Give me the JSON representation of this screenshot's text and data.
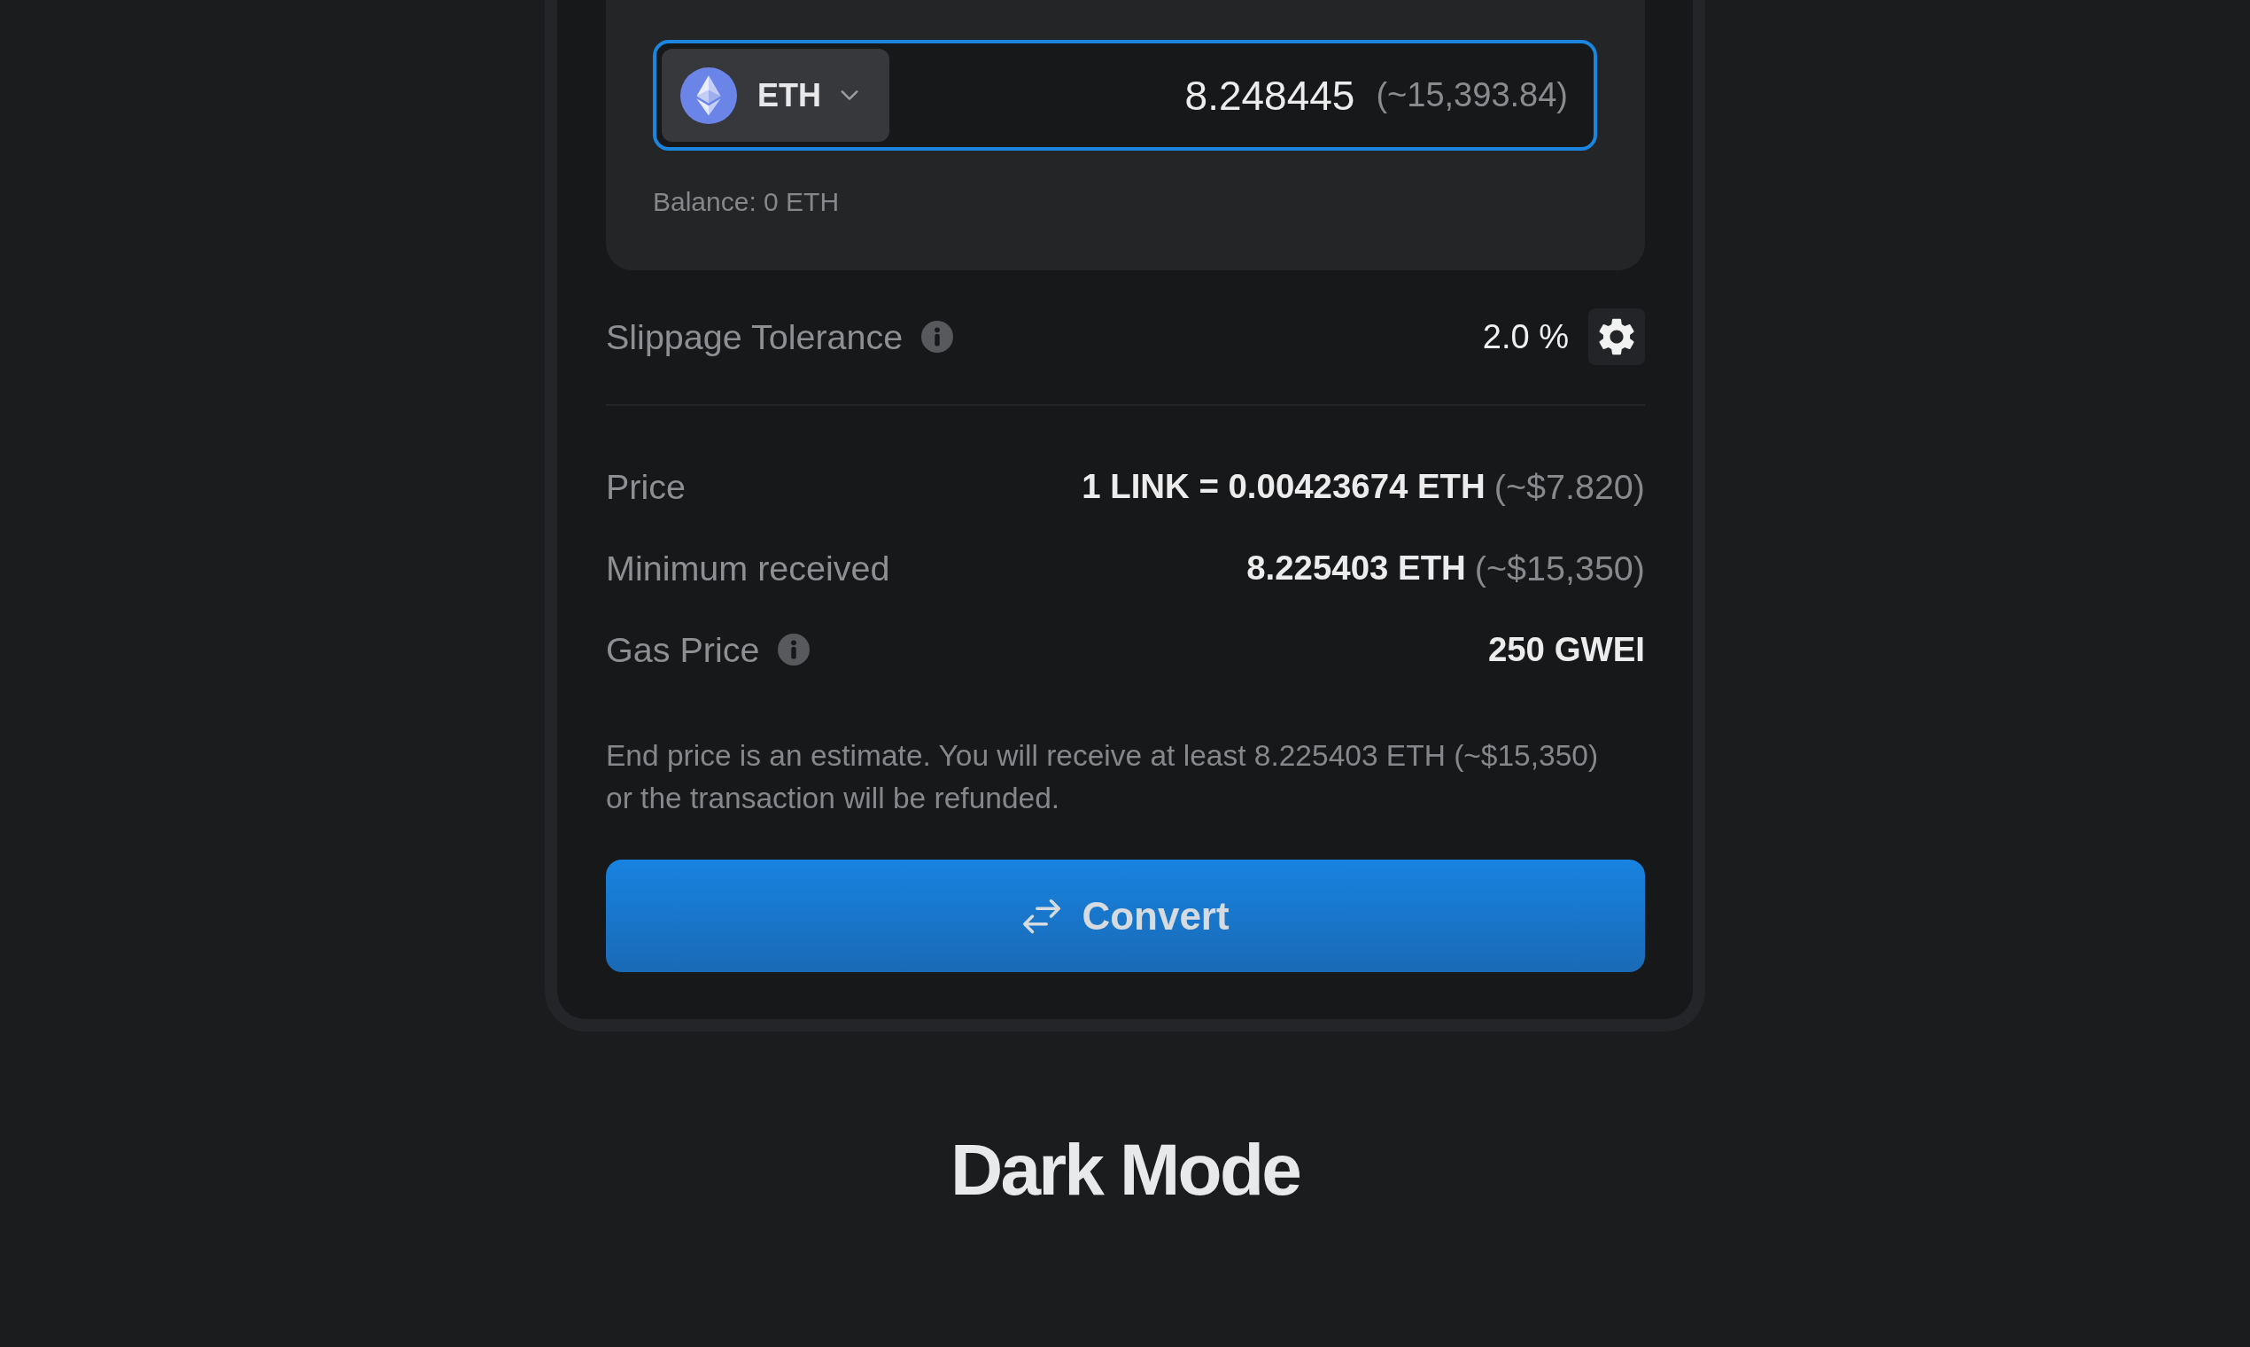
{
  "swap": {
    "token": "ETH",
    "focused": true,
    "amount": "8.248445",
    "amount_fiat": "(~15,393.84)",
    "balance": "Balance: 0 ETH"
  },
  "slippage": {
    "label": "Slippage Tolerance",
    "info": true,
    "value": "2.0 %"
  },
  "details": [
    {
      "label": "Price",
      "info": false,
      "value": "1 LINK = 0.00423674 ETH",
      "note": "(~$7.820)"
    },
    {
      "label": "Minimum received",
      "info": false,
      "value": "8.225403 ETH",
      "note": "(~$15,350)"
    },
    {
      "label": "Gas Price",
      "info": true,
      "value": "250 GWEI"
    }
  ],
  "disclaimer": "End price is an estimate. You will receive at least 8.225403 ETH (~$15,350) or the transaction will be refunded.",
  "convert_button": {
    "label": "Convert"
  },
  "caption": "Dark Mode"
}
